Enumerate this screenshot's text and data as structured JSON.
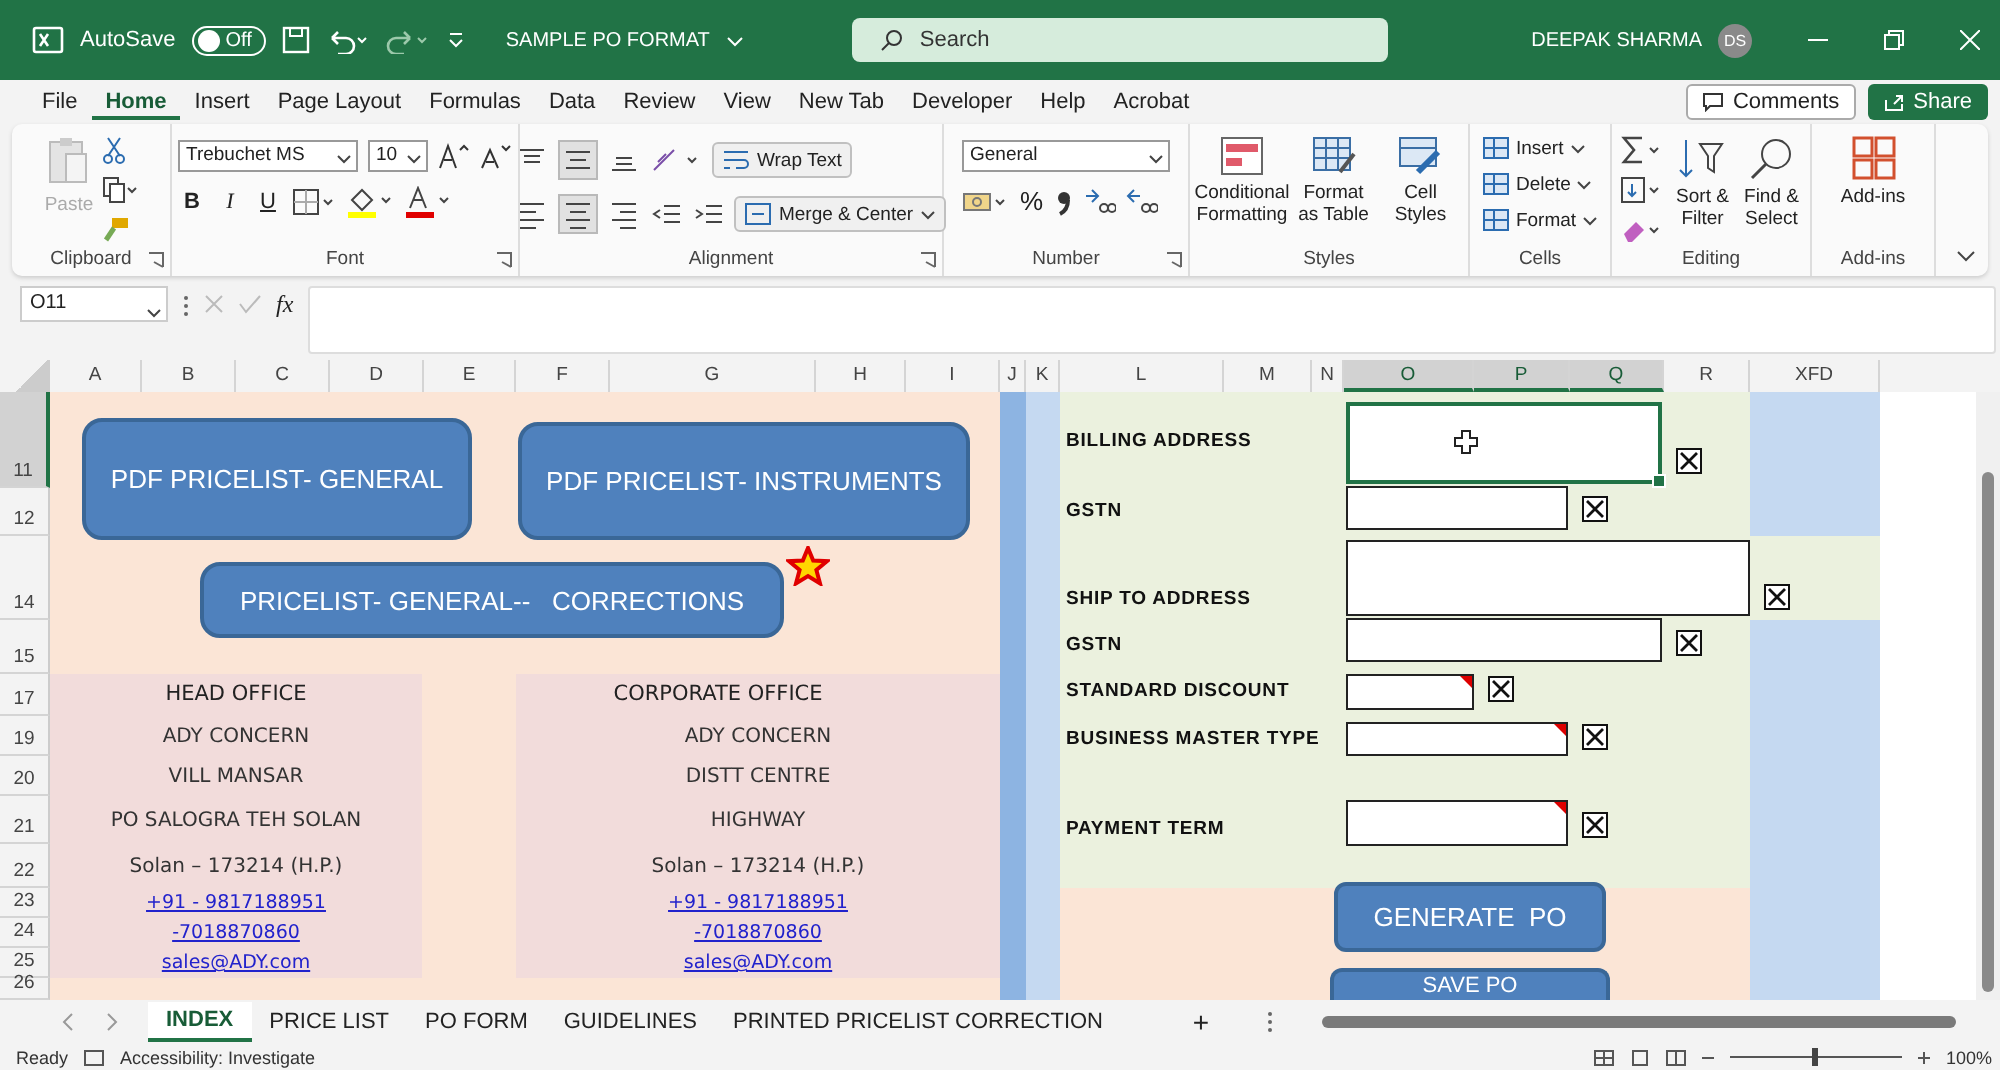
{
  "title_bar": {
    "autosave_label": "AutoSave",
    "autosave": {
      "on": false,
      "label": "Off"
    },
    "title": "SAMPLE PO FORMAT",
    "search": {
      "placeholder": "Search"
    },
    "user": {
      "name": "DEEPAK SHARMA",
      "initials": "DS"
    }
  },
  "menu_tabs": [
    {
      "label": "File",
      "selected": false
    },
    {
      "label": "Home",
      "selected": true
    },
    {
      "label": "Insert",
      "selected": false
    },
    {
      "label": "Page Layout",
      "selected": false
    },
    {
      "label": "Formulas",
      "selected": false
    },
    {
      "label": "Data",
      "selected": false
    },
    {
      "label": "Review",
      "selected": false
    },
    {
      "label": "View",
      "selected": false
    },
    {
      "label": "New Tab",
      "selected": false
    },
    {
      "label": "Developer",
      "selected": false
    },
    {
      "label": "Help",
      "selected": false
    },
    {
      "label": "Acrobat",
      "selected": false
    }
  ],
  "comments_button": "Comments",
  "share_button": "Share",
  "ribbon": {
    "groups": [
      {
        "kind": "clipboard",
        "label": "Clipboard",
        "paste": {
          "label": "Paste",
          "disabled": true
        }
      },
      {
        "kind": "font",
        "label": "Font",
        "font_name": "Trebuchet MS",
        "font_size": "10",
        "style_buttons": [
          "B",
          "I",
          "U"
        ]
      },
      {
        "kind": "alignment",
        "label": "Alignment",
        "wrap_text": "Wrap Text",
        "merge": "Merge & Center"
      },
      {
        "kind": "number",
        "label": "Number",
        "format": "General",
        "percent": "%"
      },
      {
        "kind": "styles",
        "label": "Styles",
        "buttons": [
          "Conditional Formatting",
          "Format as Table",
          "Cell Styles"
        ]
      },
      {
        "kind": "cells",
        "label": "Cells",
        "buttons": [
          "Insert",
          "Delete",
          "Format"
        ]
      },
      {
        "kind": "editing",
        "label": "Editing",
        "buttons": [
          "Sort & Filter",
          "Find & Select"
        ]
      },
      {
        "kind": "addins",
        "label": "Add-ins",
        "button": "Add-ins"
      }
    ]
  },
  "formula_bar": {
    "name_box": "O11",
    "fx": "fx"
  },
  "columns": [
    {
      "label": "A",
      "selected": false
    },
    {
      "label": "B",
      "selected": false
    },
    {
      "label": "C",
      "selected": false
    },
    {
      "label": "D",
      "selected": false
    },
    {
      "label": "E",
      "selected": false
    },
    {
      "label": "F",
      "selected": false
    },
    {
      "label": "G",
      "selected": false
    },
    {
      "label": "H",
      "selected": false
    },
    {
      "label": "I",
      "selected": false
    },
    {
      "label": "J",
      "selected": false
    },
    {
      "label": "K",
      "selected": false
    },
    {
      "label": "L",
      "selected": false
    },
    {
      "label": "M",
      "selected": false
    },
    {
      "label": "N",
      "selected": false
    },
    {
      "label": "O",
      "selected": true
    },
    {
      "label": "P",
      "selected": true
    },
    {
      "label": "Q",
      "selected": true
    },
    {
      "label": "R",
      "selected": false
    },
    {
      "label": "XFD",
      "selected": false
    }
  ],
  "rows": [
    {
      "label": "11",
      "selected": true
    },
    {
      "label": "12",
      "selected": false
    },
    {
      "label": "14",
      "selected": false
    },
    {
      "label": "15",
      "selected": false
    },
    {
      "label": "17",
      "selected": false
    },
    {
      "label": "19",
      "selected": false
    },
    {
      "label": "20",
      "selected": false
    },
    {
      "label": "21",
      "selected": false
    },
    {
      "label": "22",
      "selected": false
    },
    {
      "label": "23",
      "selected": false
    },
    {
      "label": "24",
      "selected": false
    },
    {
      "label": "25",
      "selected": false
    },
    {
      "label": "26",
      "selected": false
    }
  ],
  "sheet": {
    "shape_buttons": [
      {
        "label": "PDF PRICELIST- GENERAL"
      },
      {
        "label": "PDF PRICELIST- INSTRUMENTS"
      },
      {
        "label": "PRICELIST- GENERAL--   CORRECTIONS"
      }
    ],
    "offices": [
      {
        "title": "HEAD OFFICE",
        "lines": [
          "ADY CONCERN",
          "VILL MANSAR",
          "PO SALOGRA TEH SOLAN",
          "Solan – 173214 (H.P.)"
        ],
        "links": [
          "+91 - 9817188951",
          "-7018870860",
          "sales@ADY.com"
        ]
      },
      {
        "title": "CORPORATE OFFICE",
        "lines": [
          "ADY CONCERN",
          "DISTT CENTRE",
          "HIGHWAY",
          "Solan – 173214 (H.P.)"
        ],
        "links": [
          "+91 - 9817188951",
          "-7018870860",
          "sales@ADY.com"
        ]
      }
    ],
    "form_fields": [
      {
        "label": "BILLING ADDRESS",
        "selected": true,
        "comment": false,
        "checked": true
      },
      {
        "label": "GSTN",
        "selected": false,
        "comment": false,
        "checked": true
      },
      {
        "label": "SHIP TO ADDRESS",
        "selected": false,
        "comment": false,
        "checked": true
      },
      {
        "label": "GSTN",
        "selected": false,
        "comment": false,
        "checked": true
      },
      {
        "label": "STANDARD DISCOUNT",
        "selected": false,
        "comment": true,
        "checked": true
      },
      {
        "label": "BUSINESS MASTER TYPE",
        "selected": false,
        "comment": true,
        "checked": true
      },
      {
        "label": "PAYMENT TERM",
        "selected": false,
        "comment": true,
        "checked": true
      }
    ],
    "action_buttons": [
      "GENERATE  PO",
      "SAVE PO"
    ]
  },
  "sheet_tabs": [
    {
      "label": "INDEX",
      "selected": true
    },
    {
      "label": "PRICE LIST",
      "selected": false
    },
    {
      "label": "PO FORM",
      "selected": false
    },
    {
      "label": "GUIDELINES",
      "selected": false
    },
    {
      "label": "PRINTED PRICELIST CORRECTION",
      "selected": false
    }
  ],
  "new_sheet": "+",
  "status_bar": {
    "state": "Ready",
    "accessibility": "Accessibility: Investigate",
    "zoom_slider": {
      "level": 0.5
    },
    "zoom": "100%"
  }
}
